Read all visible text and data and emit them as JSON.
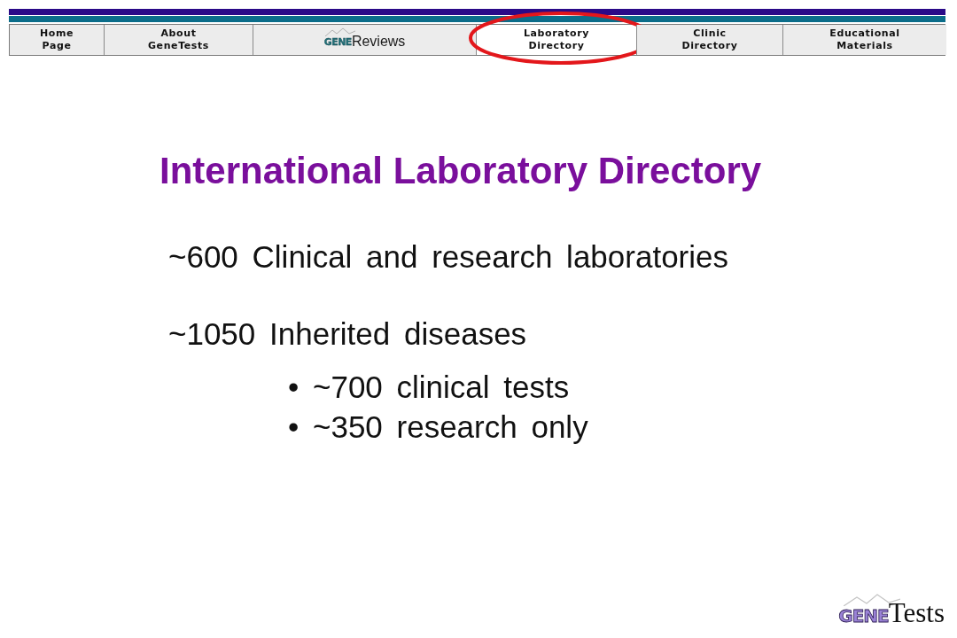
{
  "nav": {
    "tabs": [
      {
        "kind": "text",
        "lines": [
          "Home",
          "Page"
        ],
        "selected": false,
        "circled": false
      },
      {
        "kind": "text",
        "lines": [
          "About",
          "GeneTests"
        ],
        "selected": false,
        "circled": false
      },
      {
        "kind": "logo",
        "mark": "GENE",
        "label": "Reviews",
        "selected": false,
        "circled": false
      },
      {
        "kind": "text",
        "lines": [
          "Laboratory",
          "Directory"
        ],
        "selected": true,
        "circled": true
      },
      {
        "kind": "text",
        "lines": [
          "Clinic",
          "Directory"
        ],
        "selected": false,
        "circled": false
      },
      {
        "kind": "text",
        "lines": [
          "Educational",
          "Materials"
        ],
        "selected": false,
        "circled": false
      }
    ]
  },
  "title": "International Laboratory Directory",
  "stats": [
    {
      "text": "~600 Clinical and research laboratories"
    },
    {
      "text": "~1050 Inherited diseases",
      "children": [
        {
          "text": "• ~700 clinical tests"
        },
        {
          "text": "• ~350 research only"
        }
      ]
    }
  ],
  "footer_logo": {
    "mark": "GENE",
    "name": "Tests"
  }
}
